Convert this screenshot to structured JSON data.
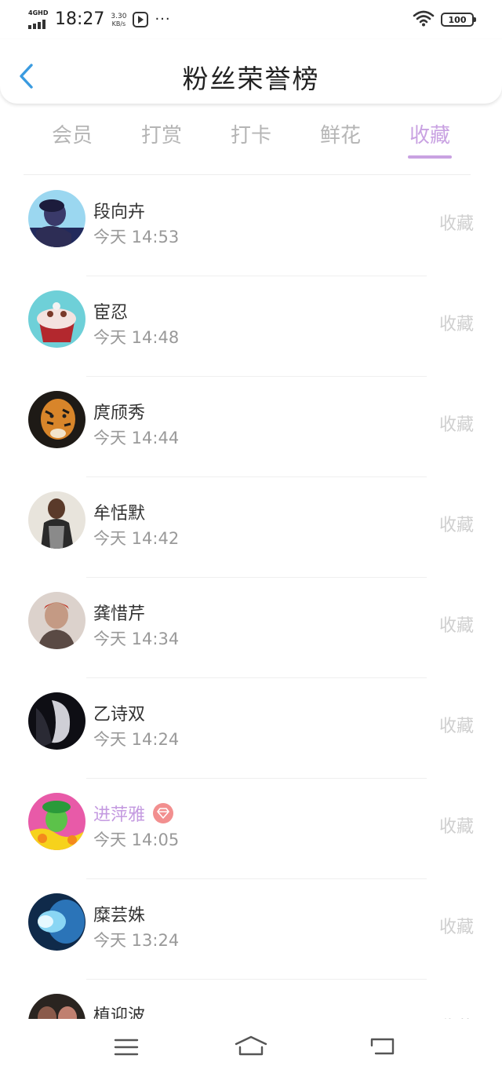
{
  "status_bar": {
    "network": "4GHD",
    "time": "18:27",
    "speed_value": "3.30",
    "speed_unit": "KB/s",
    "more": "···",
    "battery": "100"
  },
  "header": {
    "title": "粉丝荣誉榜",
    "back_icon": "chevron-left-icon"
  },
  "tabs": [
    {
      "label": "会员",
      "active": false
    },
    {
      "label": "打赏",
      "active": false
    },
    {
      "label": "打卡",
      "active": false
    },
    {
      "label": "鲜花",
      "active": false
    },
    {
      "label": "收藏",
      "active": true
    }
  ],
  "list": [
    {
      "name": "段向卉",
      "time": "今天 14:53",
      "action": "收藏",
      "vip": false
    },
    {
      "name": "宦忍",
      "time": "今天 14:48",
      "action": "收藏",
      "vip": false
    },
    {
      "name": "庹颀秀",
      "time": "今天 14:44",
      "action": "收藏",
      "vip": false
    },
    {
      "name": "牟恬默",
      "time": "今天 14:42",
      "action": "收藏",
      "vip": false
    },
    {
      "name": "龚惜芹",
      "time": "今天 14:34",
      "action": "收藏",
      "vip": false
    },
    {
      "name": "乙诗双",
      "time": "今天 14:24",
      "action": "收藏",
      "vip": false
    },
    {
      "name": "进萍雅",
      "time": "今天 14:05",
      "action": "收藏",
      "vip": true
    },
    {
      "name": "糜芸姝",
      "time": "今天 13:24",
      "action": "收藏",
      "vip": false
    },
    {
      "name": "植迎波",
      "time": "",
      "action": "收藏",
      "vip": false
    }
  ],
  "colors": {
    "accent": "#c9a2e2",
    "back_arrow": "#3a9be0",
    "vip_badge": "#f28f8f",
    "tab_inactive": "#b5b5b5",
    "action_text": "#cfcfcf"
  },
  "nav_bar": {
    "icons": [
      "menu-icon",
      "home-icon",
      "back-icon"
    ]
  }
}
